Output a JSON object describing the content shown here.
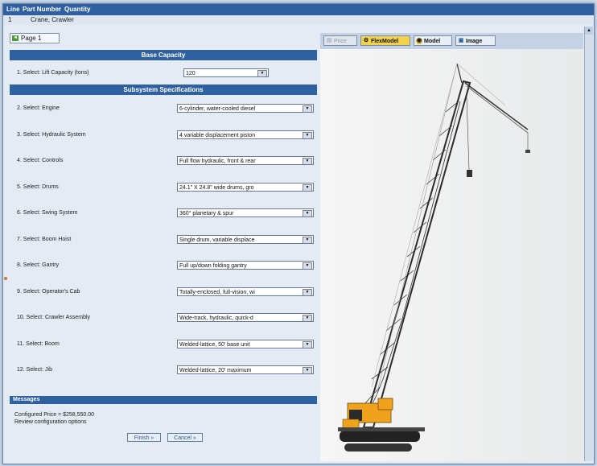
{
  "header": {
    "line_label": "Line",
    "part_number_label": "Part Number",
    "quantity_label": "Quantity"
  },
  "line_item": {
    "line": "1",
    "part": "Crane, Crawler"
  },
  "page_tab": "Page 1",
  "sections": {
    "base_capacity": "Base Capacity",
    "subsystem": "Subsystem Specifications",
    "messages": "Messages"
  },
  "questions": [
    {
      "label": "1. Select: Lift Capacity (tons)",
      "value": "120"
    },
    {
      "label": "2. Select: Engine",
      "value": "6-cylinder, water-cooled diesel"
    },
    {
      "label": "3. Select: Hydraulic System",
      "value": "4 variable displacement piston"
    },
    {
      "label": "4. Select: Controls",
      "value": "Full flow hydraulic, front & rear"
    },
    {
      "label": "5. Select: Drums",
      "value": "24.1\" X 24.8\" wide drums, gro"
    },
    {
      "label": "6. Select: Swing System",
      "value": "360° planetary & spur"
    },
    {
      "label": "7. Select: Boom Hoist",
      "value": "Single drum, variable displace"
    },
    {
      "label": "8. Select: Gantry",
      "value": "Full up/down folding gantry"
    },
    {
      "label": "9. Select: Operator's Cab",
      "value": "Totally-enclosed, full-vision, wi"
    },
    {
      "label": "10. Select: Crawler Assembly",
      "value": "Wide-track, hydraulic, quick-d"
    },
    {
      "label": "11. Select: Boom",
      "value": "Welded-lattice, 50' base unit"
    },
    {
      "label": "12. Select: Jib",
      "value": "Welded-lattice, 20' maximum"
    }
  ],
  "messages": {
    "price": "Configured Price = $258,550.00",
    "review": "Review configuration options"
  },
  "buttons": {
    "finish": "Finish »",
    "cancel": "Cancel »"
  },
  "right_tabs": [
    {
      "label": "Price",
      "icon": "price-icon"
    },
    {
      "label": "FlexModel",
      "icon": "flexmodel-icon"
    },
    {
      "label": "Model",
      "icon": "model-icon"
    },
    {
      "label": "Image",
      "icon": "image-icon"
    }
  ],
  "colors": {
    "header_bar": "#2f61a0",
    "tab_highlight": "#f2d34a",
    "crane_body": "#f0a21c"
  }
}
